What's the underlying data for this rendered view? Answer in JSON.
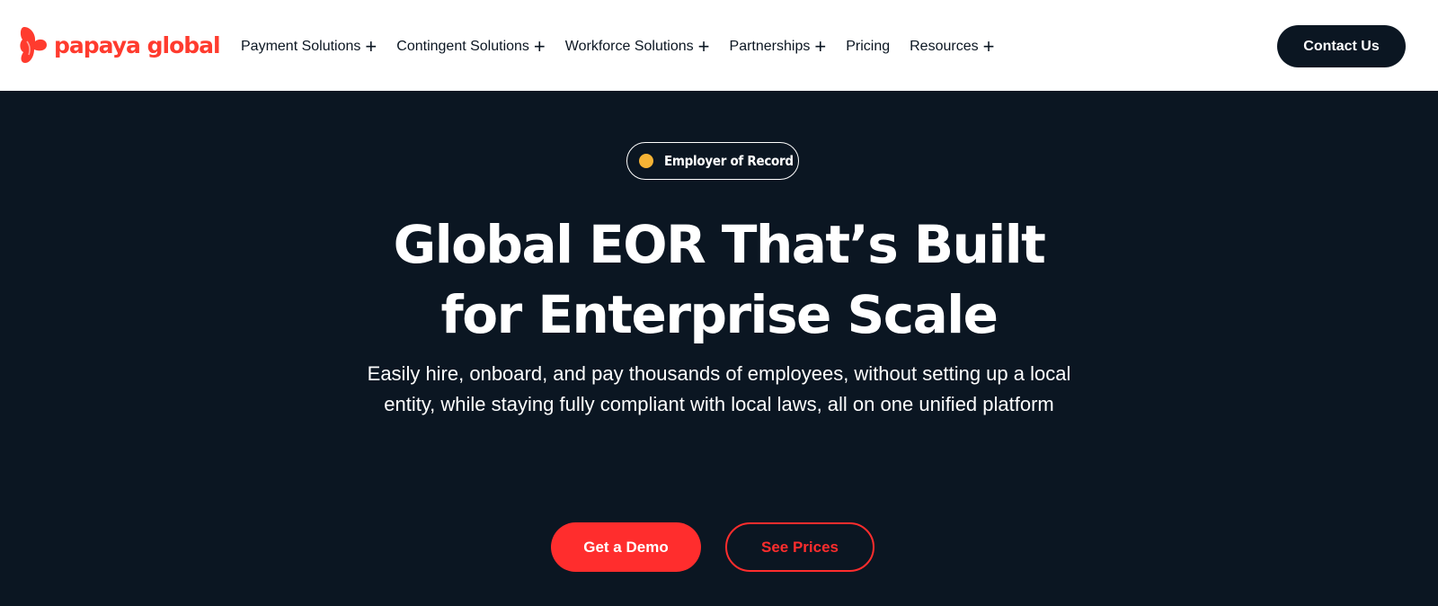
{
  "header": {
    "logo_text": "papaya global",
    "logo_icon": "papaya-logo-icon",
    "nav": [
      {
        "label": "Payment Solutions",
        "expandable": true
      },
      {
        "label": "Contingent Solutions",
        "expandable": true
      },
      {
        "label": "Workforce Solutions",
        "expandable": true
      },
      {
        "label": "Partnerships",
        "expandable": true
      },
      {
        "label": "Pricing",
        "expandable": false
      },
      {
        "label": "Resources",
        "expandable": true
      }
    ],
    "contact_label": "Contact Us"
  },
  "hero": {
    "badge_label": "Employer of Record",
    "headline_line1": "Global EOR That’s Built",
    "headline_line2": "for Enterprise Scale",
    "subhead": "Easily hire, onboard, and pay thousands of employees, without setting up a local entity, while staying fully compliant with local laws, all on one unified platform",
    "demo_label": "Get a Demo",
    "prices_label": "See Prices"
  },
  "colors": {
    "brand": "#ff3b2e",
    "navy": "#0b1622",
    "accent_red": "#ff2d2d",
    "badge_dot": "#f5b335",
    "white": "#ffffff"
  }
}
